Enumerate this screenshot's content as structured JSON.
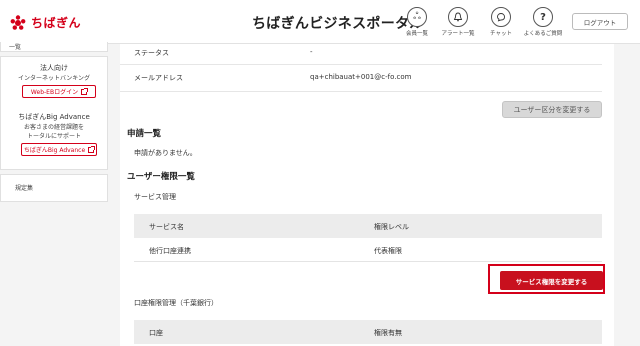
{
  "header": {
    "logo_text": "ちばぎん",
    "portal_title_main": "ちばぎん",
    "portal_title_sub": "ビジネスポータル",
    "nav": [
      {
        "label": "会員一覧",
        "icon": "users-icon",
        "glyph": "ஃ"
      },
      {
        "label": "アラート一覧",
        "icon": "bell-icon",
        "glyph": "♢"
      },
      {
        "label": "チャット",
        "icon": "chat-icon",
        "glyph": "◌"
      },
      {
        "label": "よくあるご質問",
        "icon": "question-icon",
        "glyph": "?"
      }
    ],
    "logout_label": "ログアウト"
  },
  "sidebar": {
    "top_label": "一覧",
    "corp_title": "法人向け",
    "corp_sub": "インターネットバンキング",
    "webeb_button": "Web-EBログイン",
    "bigadv_title": "ちばぎんBig Advance",
    "bigadv_sub1": "お客さまの経営課題を",
    "bigadv_sub2": "トータルにサポート",
    "bigadv_button": "ちばぎんBig Advance",
    "bottom_label": "規定集"
  },
  "main": {
    "status_label": "ステータス",
    "status_value": "-",
    "email_label": "メールアドレス",
    "email_value": "qa+chibauat+001@c-fo.com",
    "change_user_type_button": "ユーザー区分を変更する",
    "application_heading": "申請一覧",
    "no_application_text": "申請がありません。",
    "permission_heading": "ユーザー権限一覧",
    "service_mgmt_label": "サービス管理",
    "service_table": {
      "headers": [
        "サービス名",
        "権限レベル"
      ],
      "rows": [
        [
          "他行口座連携",
          "代表権限"
        ]
      ]
    },
    "change_service_permission_button": "サービス権限を変更する",
    "account_mgmt_label": "口座権限管理（千葉銀行）",
    "account_table": {
      "headers": [
        "口座",
        "権限有無"
      ]
    }
  },
  "colors": {
    "brand_red": "#d4001a",
    "button_red": "#c8101e"
  }
}
